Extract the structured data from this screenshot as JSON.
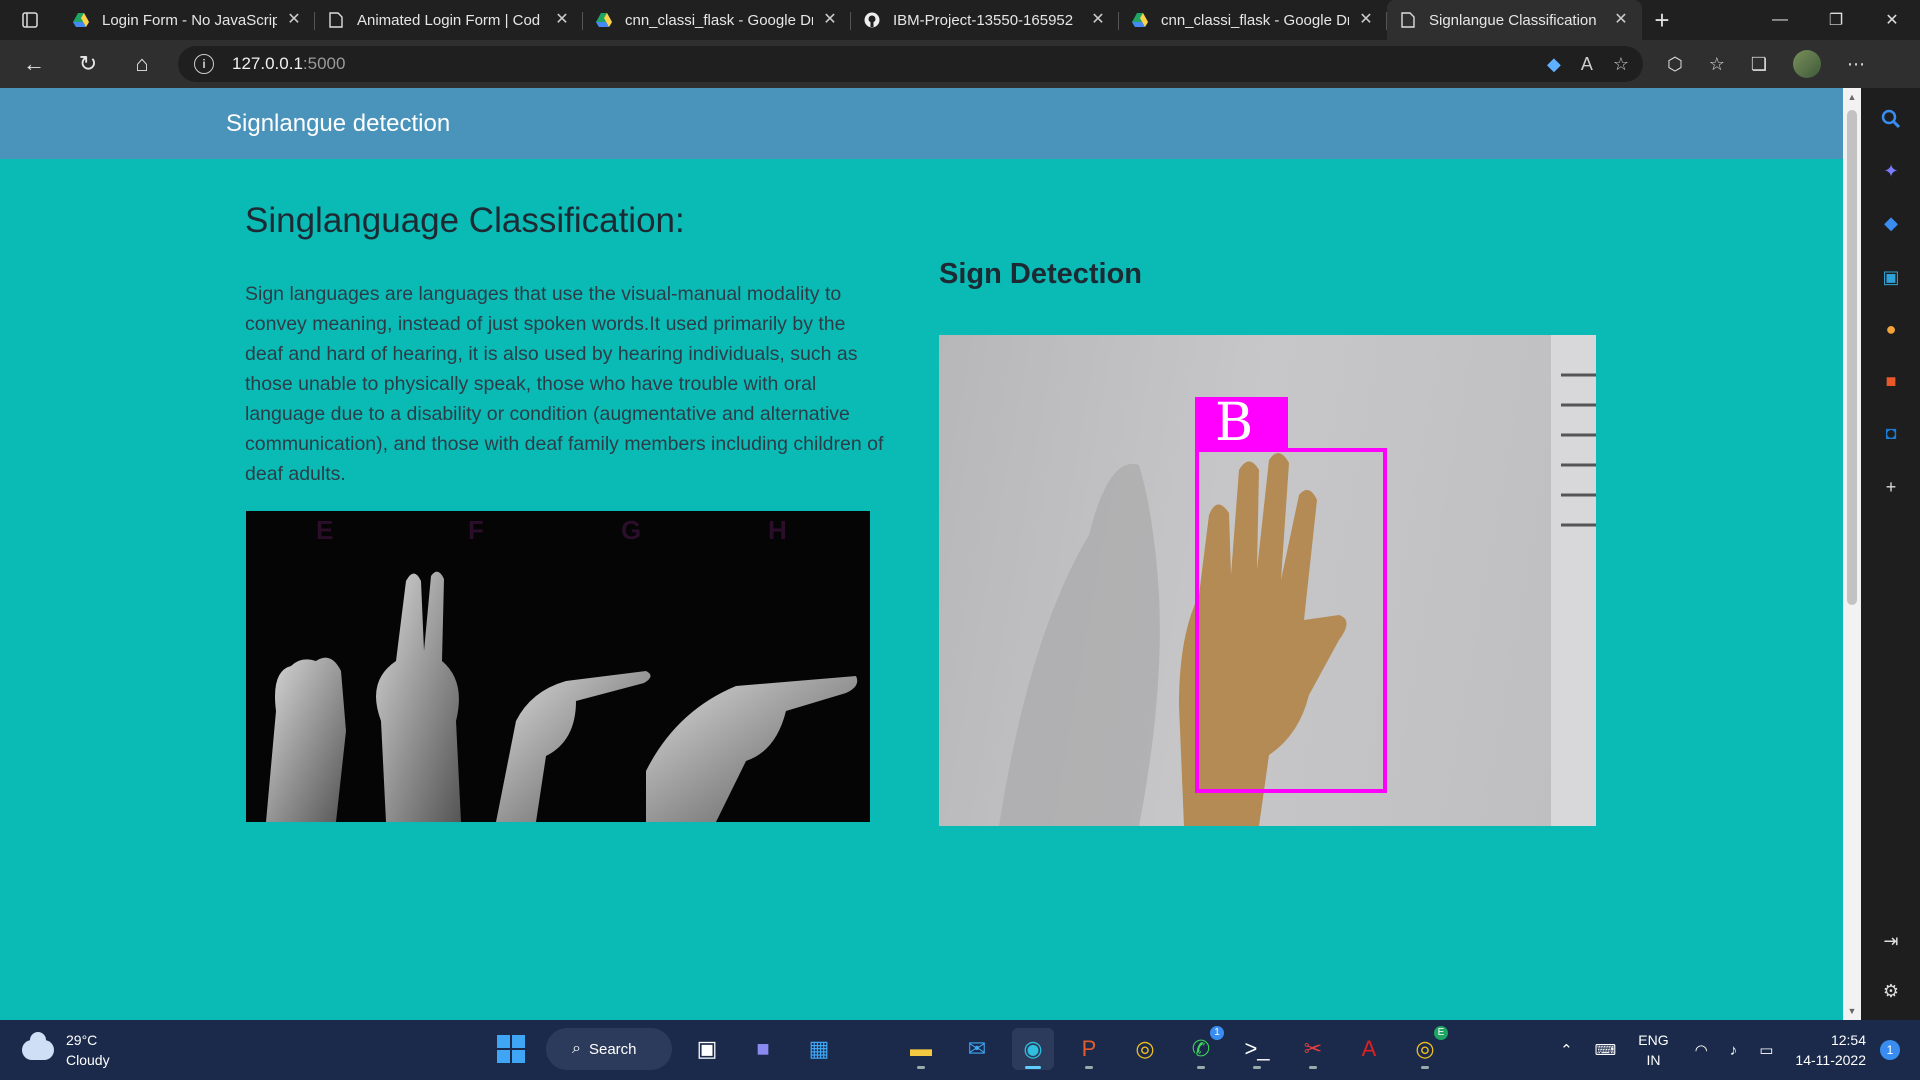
{
  "browser": {
    "tabs": [
      {
        "title": "Login Form - No JavaScript",
        "icon": "google-drive-icon"
      },
      {
        "title": "Animated Login Form | Cod",
        "icon": "page-icon"
      },
      {
        "title": "cnn_classi_flask - Google Dr",
        "icon": "google-drive-icon"
      },
      {
        "title": "IBM-Project-13550-165952",
        "icon": "github-icon"
      },
      {
        "title": "cnn_classi_flask - Google Dr",
        "icon": "google-drive-icon"
      },
      {
        "title": "Signlangue Classification",
        "icon": "page-icon",
        "active": true
      }
    ],
    "address": {
      "host": "127.0.0.1",
      "port": ":5000"
    }
  },
  "site": {
    "header_title": "Signlangue detection",
    "heading": "Singlanguage Classification:",
    "description": "Sign languages are languages that use the visual-manual modality to convey meaning, instead of just spoken words.It used primarily by the deaf and hard of hearing, it is also used by hearing individuals, such as those unable to physically speak, those who have trouble with oral language due to a disability or condition (augmentative and alternative communication), and those with deaf family members including children of deaf adults.",
    "asl_letters": [
      "E",
      "F",
      "G",
      "H"
    ],
    "detection_heading": "Sign Detection",
    "detected_letter": "B"
  },
  "taskbar": {
    "weather": {
      "temp": "29°C",
      "condition": "Cloudy"
    },
    "search_label": "Search",
    "lang": {
      "top": "ENG",
      "bottom": "IN"
    },
    "clock": {
      "time": "12:54",
      "date": "14-11-2022"
    },
    "notification_count": "1",
    "whatsapp_badge": "1",
    "chrome_badge": "E"
  },
  "colors": {
    "page_bg": "#0abab5",
    "header_bg": "#4a94bb",
    "detect_box": "#ff00ff"
  }
}
